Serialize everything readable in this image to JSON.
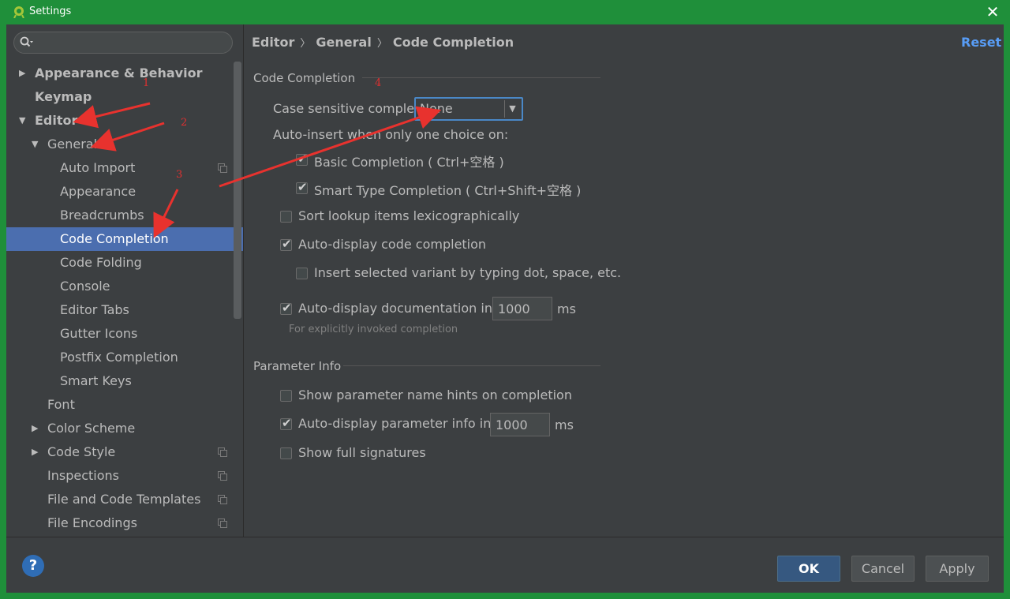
{
  "window": {
    "title": "Settings"
  },
  "search": {
    "placeholder": ""
  },
  "tree": [
    {
      "label": "Appearance & Behavior",
      "arrow": "▶",
      "bold": true,
      "indent": 0
    },
    {
      "label": "Keymap",
      "arrow": "",
      "bold": true,
      "indent": 0
    },
    {
      "label": "Editor",
      "arrow": "▼",
      "bold": true,
      "indent": 0
    },
    {
      "label": "General",
      "arrow": "▼",
      "bold": false,
      "indent": 1
    },
    {
      "label": "Auto Import",
      "arrow": "",
      "bold": false,
      "indent": 2,
      "icon": true
    },
    {
      "label": "Appearance",
      "arrow": "",
      "bold": false,
      "indent": 2
    },
    {
      "label": "Breadcrumbs",
      "arrow": "",
      "bold": false,
      "indent": 2
    },
    {
      "label": "Code Completion",
      "arrow": "",
      "bold": false,
      "indent": 2,
      "selected": true
    },
    {
      "label": "Code Folding",
      "arrow": "",
      "bold": false,
      "indent": 2
    },
    {
      "label": "Console",
      "arrow": "",
      "bold": false,
      "indent": 2
    },
    {
      "label": "Editor Tabs",
      "arrow": "",
      "bold": false,
      "indent": 2
    },
    {
      "label": "Gutter Icons",
      "arrow": "",
      "bold": false,
      "indent": 2
    },
    {
      "label": "Postfix Completion",
      "arrow": "",
      "bold": false,
      "indent": 2
    },
    {
      "label": "Smart Keys",
      "arrow": "",
      "bold": false,
      "indent": 2
    },
    {
      "label": "Font",
      "arrow": "",
      "bold": false,
      "indent": 1
    },
    {
      "label": "Color Scheme",
      "arrow": "▶",
      "bold": false,
      "indent": 1
    },
    {
      "label": "Code Style",
      "arrow": "▶",
      "bold": false,
      "indent": 1,
      "icon": true
    },
    {
      "label": "Inspections",
      "arrow": "",
      "bold": false,
      "indent": 1,
      "icon": true
    },
    {
      "label": "File and Code Templates",
      "arrow": "",
      "bold": false,
      "indent": 1,
      "icon": true
    },
    {
      "label": "File Encodings",
      "arrow": "",
      "bold": false,
      "indent": 1,
      "icon": true
    }
  ],
  "breadcrumb": [
    "Editor",
    "General",
    "Code Completion"
  ],
  "reset_label": "Reset",
  "code_completion": {
    "section_title": "Code Completion",
    "case_label": "Case sensitive completion:",
    "case_value": "None",
    "auto_insert_label": "Auto-insert when only one choice on:",
    "basic_completion": {
      "label": "Basic Completion ( Ctrl+空格 )",
      "checked": true
    },
    "smart_type_completion": {
      "label": "Smart Type Completion ( Ctrl+Shift+空格 )",
      "checked": true
    },
    "sort_lookup": {
      "label": "Sort lookup items lexicographically",
      "checked": false
    },
    "auto_display_completion": {
      "label": "Auto-display code completion",
      "checked": true
    },
    "insert_variant": {
      "label": "Insert selected variant by typing dot, space, etc.",
      "checked": false
    },
    "auto_display_docs": {
      "label": "Auto-display documentation in",
      "checked": true,
      "value": "1000",
      "unit": "ms"
    },
    "docs_hint": "For explicitly invoked completion"
  },
  "parameter_info": {
    "section_title": "Parameter Info",
    "show_hints": {
      "label": "Show parameter name hints on completion",
      "checked": false
    },
    "auto_display_param": {
      "label": "Auto-display parameter info in",
      "checked": true,
      "value": "1000",
      "unit": "ms"
    },
    "full_signatures": {
      "label": "Show full signatures",
      "checked": false
    }
  },
  "footer": {
    "ok": "OK",
    "cancel": "Cancel",
    "apply": "Apply",
    "help": "?"
  },
  "annotations": [
    "1",
    "2",
    "3",
    "4"
  ],
  "colors": {
    "titlebar": "#1f8f3a",
    "panel": "#3c3f41",
    "selection": "#4b6eaf",
    "accent": "#589df6",
    "annotation": "#e03030"
  }
}
